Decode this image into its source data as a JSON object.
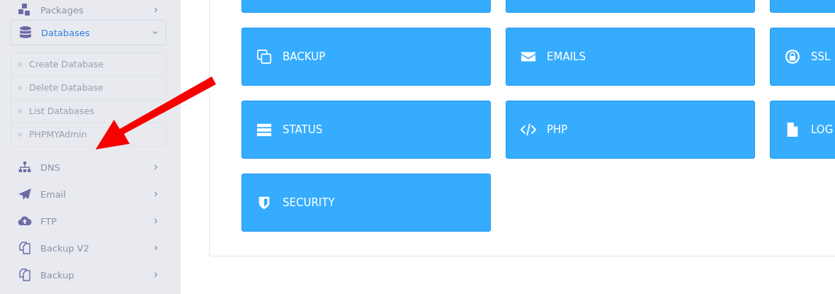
{
  "sidebar": {
    "items": [
      {
        "label": "Packages",
        "expanded": false
      },
      {
        "label": "Databases",
        "expanded": true,
        "children": [
          {
            "label": "Create Database"
          },
          {
            "label": "Delete Database"
          },
          {
            "label": "List Databases"
          },
          {
            "label": "PHPMYAdmin"
          }
        ]
      },
      {
        "label": "DNS",
        "expanded": false
      },
      {
        "label": "Email",
        "expanded": false
      },
      {
        "label": "FTP",
        "expanded": false
      },
      {
        "label": "Backup V2",
        "expanded": false
      },
      {
        "label": "Backup",
        "expanded": false
      }
    ]
  },
  "tiles": [
    {
      "kind": "cut"
    },
    {
      "kind": "cut"
    },
    {
      "kind": "cut"
    },
    {
      "kind": "tile",
      "label": "BACKUP"
    },
    {
      "kind": "tile",
      "label": "EMAILS"
    },
    {
      "kind": "tile",
      "label": "SSL"
    },
    {
      "kind": "tile",
      "label": "STATUS"
    },
    {
      "kind": "tile",
      "label": "PHP"
    },
    {
      "kind": "tile",
      "label": "LOG"
    },
    {
      "kind": "tile",
      "label": "SECURITY"
    }
  ],
  "annotation": {
    "kind": "arrow"
  }
}
